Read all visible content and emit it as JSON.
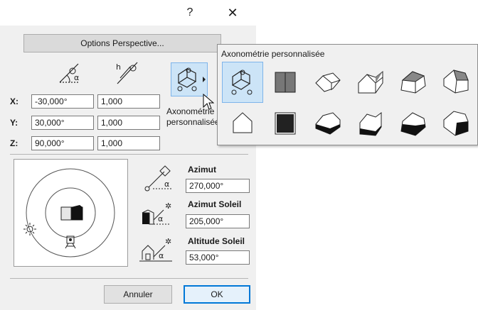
{
  "titlebar": {
    "help_label": "?",
    "close_label": "✕"
  },
  "options_button": "Options Perspective...",
  "rotation_fields": [
    {
      "axis": "X:",
      "angle": "-30,000°",
      "scale": "1,000"
    },
    {
      "axis": "Y:",
      "angle": "30,000°",
      "scale": "1,000"
    },
    {
      "axis": "Z:",
      "angle": "90,000°",
      "scale": "1,000"
    }
  ],
  "projection": {
    "label_line1": "Axonométrie",
    "label_line2": "personnalisée"
  },
  "azimut": {
    "label": "Azimut",
    "value": "270,000°"
  },
  "azimut_soleil": {
    "label": "Azimut Soleil",
    "value": "205,000°"
  },
  "altitude_soleil": {
    "label": "Altitude Soleil",
    "value": "53,000°"
  },
  "footer": {
    "cancel_label": "Annuler",
    "ok_label": "OK"
  },
  "popup": {
    "title": "Axonométrie personnalisée",
    "row1": [
      "axo-custom-icon",
      "elevation-icon",
      "iso-house-1-icon",
      "iso-house-2-icon",
      "iso-house-3-icon",
      "iso-house-4-icon"
    ],
    "row2": [
      "house-outline-icon",
      "plan-dark-icon",
      "house-dark-base-1-icon",
      "house-dark-base-2-icon",
      "house-dark-base-3-icon",
      "house-dark-base-4-icon"
    ]
  },
  "colors": {
    "accent": "#0078d7",
    "selection": "#cce4f7",
    "dialog_bg": "#f0f0f0"
  }
}
